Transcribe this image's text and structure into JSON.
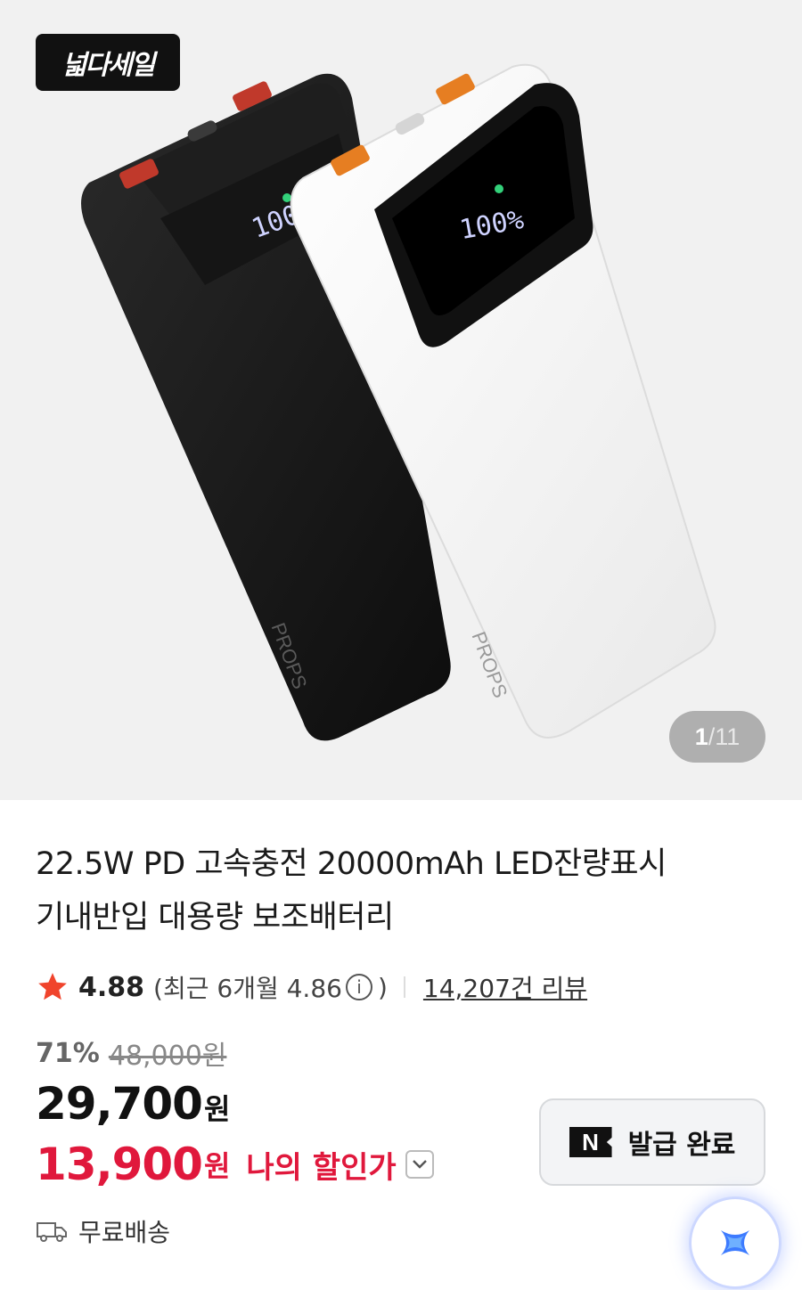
{
  "badge": {
    "label": "넓다세일"
  },
  "gallery": {
    "current": "1",
    "separator": "/",
    "total": "11"
  },
  "product": {
    "title_line1": "22.5W PD 고속충전 20000mAh LED잔량표시",
    "title_line2": "기내반입 대용량 보조배터리",
    "art_text": {
      "brand": "PROPS",
      "display": "100%"
    }
  },
  "rating": {
    "score": "4.88",
    "recent_label": "(최근 6개월 4.86",
    "recent_close": ")",
    "info_glyph": "i",
    "reviews": "14,207건 리뷰"
  },
  "pricing": {
    "discount_rate": "71%",
    "original_price": "48,000원",
    "sale_price": "29,700",
    "sale_currency": "원",
    "my_price": "13,900",
    "my_currency": "원",
    "my_label": "나의 할인가"
  },
  "coupon": {
    "icon_letter": "N",
    "label": "발급 완료"
  },
  "shipping": {
    "label": "무료배송"
  },
  "colors": {
    "accent_red": "#e0183c",
    "star": "#f0442c"
  }
}
